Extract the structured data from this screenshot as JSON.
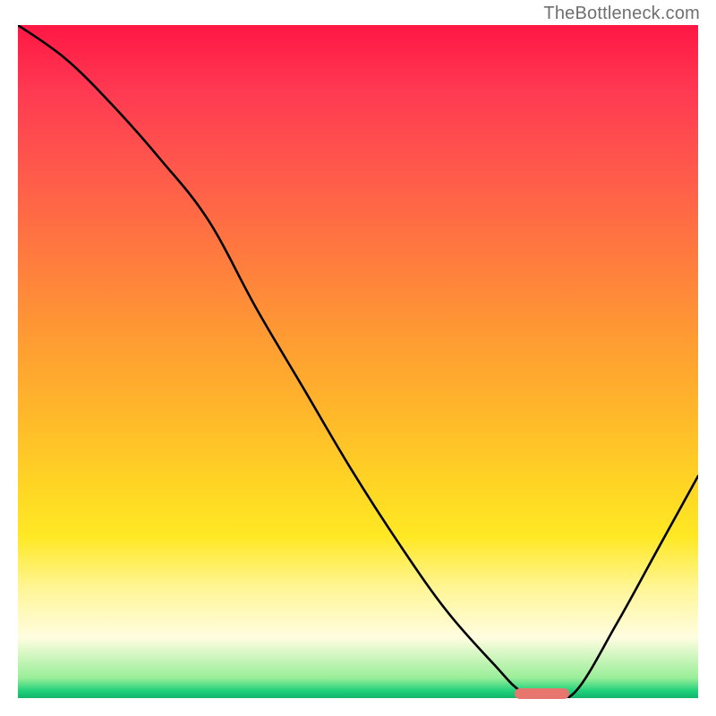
{
  "watermark": "TheBottleneck.com",
  "chart_data": {
    "type": "line",
    "title": "",
    "xlabel": "",
    "ylabel": "",
    "xlim": [
      0,
      100
    ],
    "ylim": [
      0,
      100
    ],
    "grid": false,
    "series": [
      {
        "name": "curve",
        "x": [
          0,
          7,
          14,
          21,
          28,
          35,
          42,
          49,
          56,
          63,
          70,
          74,
          78,
          82,
          88,
          94,
          100
        ],
        "values": [
          100,
          95,
          88,
          80,
          71,
          58,
          46,
          34,
          23,
          13,
          5,
          1,
          0,
          1,
          11,
          22,
          33
        ]
      }
    ],
    "annotations": [
      {
        "name": "bottleneck-marker",
        "x_start": 73,
        "x_end": 81,
        "y": 0.6,
        "color": "#e7766f"
      }
    ]
  }
}
